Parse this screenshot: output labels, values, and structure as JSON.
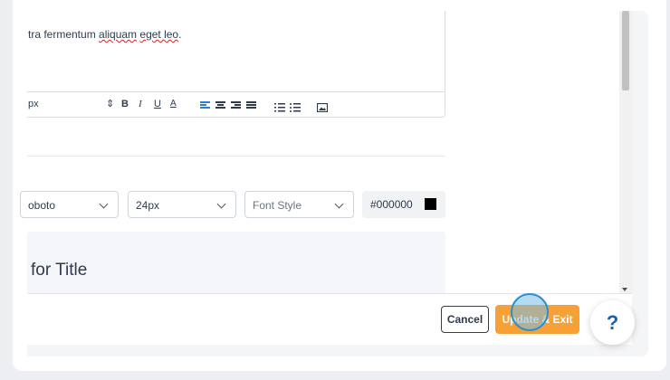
{
  "editor": {
    "body_prefix": "tra fermentum ",
    "body_misspelled_1": "aliquam",
    "body_space": " ",
    "body_misspelled_2": "eget leo",
    "body_suffix": "."
  },
  "toolbar": {
    "font_size_partial": "px",
    "stepper": "⇕",
    "bold": "B",
    "italic": "I",
    "underline": "U",
    "font_color": "A"
  },
  "title_style": {
    "font_family_partial": "oboto",
    "font_size": "24px",
    "font_style_placeholder": "Font Style",
    "color_hex": "#000000",
    "color_swatch": "#000000"
  },
  "preview": {
    "text_partial": "for Title"
  },
  "footer": {
    "cancel_label": "Cancel",
    "update_exit_label": "Update & Exit",
    "help_label": "?"
  },
  "colors": {
    "accent_orange": "#f7a036",
    "help_blue": "#1d5fb3",
    "active_align_blue": "#2b7de0"
  }
}
